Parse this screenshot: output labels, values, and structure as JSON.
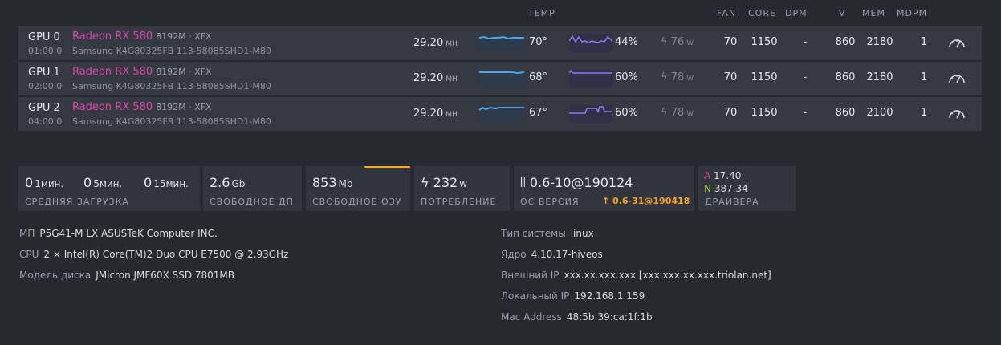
{
  "headers": {
    "temp": "TEMP",
    "fan": "FAN",
    "core": "CORE",
    "dpm": "DPM",
    "v": "V",
    "mem": "MEM",
    "mdpm": "MDPM"
  },
  "gpus": [
    {
      "id": "GPU 0",
      "bus": "01:00.0",
      "model": "Radeon RX 580",
      "memory": "8192M · XFX",
      "chip": "Samsung K4G80325FB 113-58085SHD1-M80",
      "hashrate": "29.20",
      "hash_unit": "MH",
      "temp": "70°",
      "fan_pct": "44%",
      "power": "76",
      "power_unit": "W",
      "fan": "70",
      "core": "1150",
      "dpm": "-",
      "v": "860",
      "mem": "2180",
      "mdpm": "1"
    },
    {
      "id": "GPU 1",
      "bus": "02:00.0",
      "model": "Radeon RX 580",
      "memory": "8192M · XFX",
      "chip": "Samsung K4G80325FB 113-58085SHD1-M80",
      "hashrate": "29.20",
      "hash_unit": "MH",
      "temp": "68°",
      "fan_pct": "60%",
      "power": "78",
      "power_unit": "W",
      "fan": "70",
      "core": "1150",
      "dpm": "-",
      "v": "860",
      "mem": "2180",
      "mdpm": "1"
    },
    {
      "id": "GPU 2",
      "bus": "04:00.0",
      "model": "Radeon RX 580",
      "memory": "8192M · XFX",
      "chip": "Samsung K4G80325FB 113-58085SHD1-M80",
      "hashrate": "29.20",
      "hash_unit": "MH",
      "temp": "67°",
      "fan_pct": "60%",
      "power": "78",
      "power_unit": "W",
      "fan": "70",
      "core": "1150",
      "dpm": "-",
      "v": "860",
      "mem": "2100",
      "mdpm": "1"
    }
  ],
  "stats": {
    "load": {
      "v1": "0",
      "u1": "1мин.",
      "v5": "0",
      "u5": "5мин.",
      "v15": "0",
      "u15": "15мин.",
      "label": "СРЕДНЯЯ ЗАГРУЗКА"
    },
    "disk": {
      "value": "2.6",
      "unit": "Gb",
      "label": "СВОБОДНОЕ ДП"
    },
    "ram": {
      "value": "853",
      "unit": "Mb",
      "label": "СВОБОДНОЕ ОЗУ"
    },
    "power": {
      "value": "232",
      "unit": "w",
      "label": "ПОТРЕБЛЕНИЕ"
    },
    "os": {
      "value": "0.6-10@190124",
      "update": "0.6-31@190418",
      "label": "ОС ВЕРСИЯ"
    },
    "drivers": {
      "a_key": "A",
      "a_val": "17.40",
      "n_key": "N",
      "n_val": "387.34",
      "label": "ДРАЙВЕРА"
    }
  },
  "info_left": [
    {
      "k": "МП",
      "v": "P5G41-M LX ASUSTeK Computer INC."
    },
    {
      "k": "CPU",
      "v": "2 × Intel(R) Core(TM)2 Duo CPU E7500 @ 2.93GHz"
    },
    {
      "k": "Модель диска",
      "v": "JMicron JMF60X SSD 7801MB"
    }
  ],
  "info_right": [
    {
      "k": "Тип системы",
      "v": "linux"
    },
    {
      "k": "Ядро",
      "v": "4.10.17-hiveos"
    },
    {
      "k": "Внешний IP",
      "v": "xxx.xx.xxx.xxx [xxx.xxx.xx.xxx.triolan.net]"
    },
    {
      "k": "Локальный IP",
      "v": "192.168.1.159"
    },
    {
      "k": "Mac Address",
      "v": "48:5b:39:ca:1f:1b"
    }
  ],
  "colors": {
    "accent_pink": "#d946a8",
    "accent_orange": "#f5a623",
    "temp_line": "#4da6e8",
    "fan_line": "#8a7cf0",
    "drv_a": "#d946a8",
    "drv_n": "#a6d23a"
  }
}
